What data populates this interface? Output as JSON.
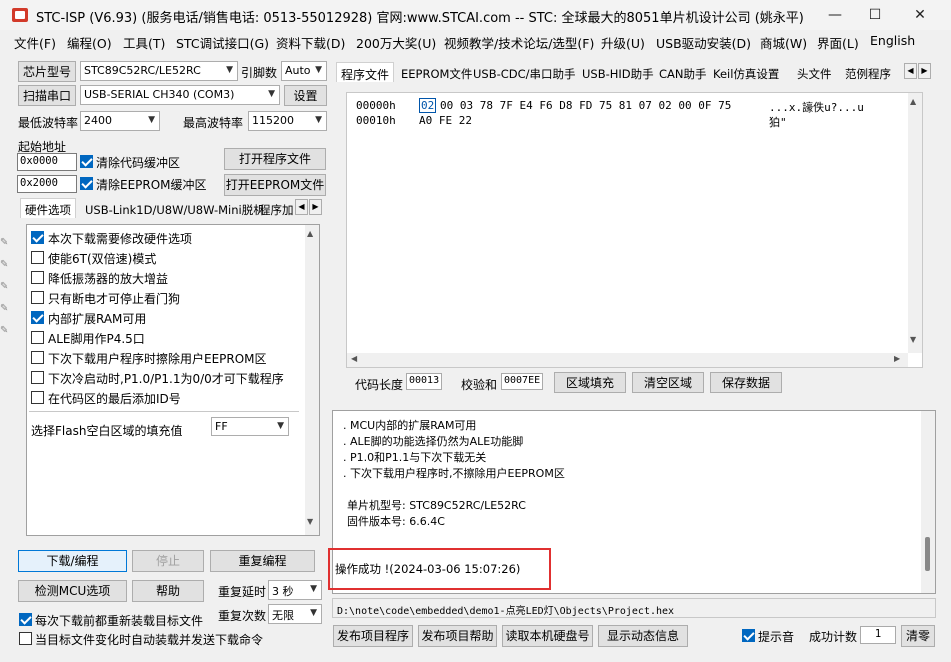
{
  "window": {
    "title": "STC-ISP (V6.93) (服务电话/销售电话: 0513-55012928) 官网:www.STCAI.com  -- STC: 全球最大的8051单片机设计公司 (姚永平)",
    "minimize": "—",
    "maximize": "☐",
    "close": "✕"
  },
  "menu": [
    "文件(F)",
    "编程(O)",
    "工具(T)",
    "STC调试接口(G)",
    "资料下载(D)",
    "200万大奖(U)",
    "视频教学/技术论坛/选型(F)",
    "升级(U)",
    "USB驱动安装(D)",
    "商城(W)",
    "界面(L)",
    "English"
  ],
  "left": {
    "chip_type_btn": "芯片型号",
    "chip_type_value": "STC89C52RC/LE52RC",
    "pin_count_label": "引脚数",
    "pin_count_value": "Auto",
    "scan_port_btn": "扫描串口",
    "port_value": "USB-SERIAL CH340 (COM3)",
    "settings_btn": "设置",
    "min_baud_label": "最低波特率",
    "min_baud_value": "2400",
    "max_baud_label": "最高波特率",
    "max_baud_value": "115200",
    "start_addr_label": "起始地址",
    "code_addr": "0x0000",
    "clear_code_label": "清除代码缓冲区",
    "open_prog_btn": "打开程序文件",
    "eeprom_addr": "0x2000",
    "clear_eeprom_label": "清除EEPROM缓冲区",
    "open_eeprom_btn": "打开EEPROM文件",
    "hw_tabs": [
      "硬件选项",
      "USB-Link1D/U8W/U8W-Mini脱机",
      "程序加"
    ],
    "options": [
      {
        "label": "本次下载需要修改硬件选项",
        "checked": true
      },
      {
        "label": "使能6T(双倍速)模式",
        "checked": false
      },
      {
        "label": "降低振荡器的放大增益",
        "checked": false
      },
      {
        "label": "只有断电才可停止看门狗",
        "checked": false
      },
      {
        "label": "内部扩展RAM可用",
        "checked": true
      },
      {
        "label": "ALE脚用作P4.5口",
        "checked": false
      },
      {
        "label": "下次下载用户程序时擦除用户EEPROM区",
        "checked": false
      },
      {
        "label": "下次冷启动时,P1.0/P1.1为0/0才可下载程序",
        "checked": false
      },
      {
        "label": "在代码区的最后添加ID号",
        "checked": false
      }
    ],
    "fill_label": "选择Flash空白区域的填充值",
    "fill_value": "FF",
    "download_btn": "下载/编程",
    "stop_btn": "停止",
    "reprogram_btn": "重复编程",
    "check_mcu_btn": "检测MCU选项",
    "help_btn": "帮助",
    "repeat_delay_label": "重复延时",
    "repeat_delay_value": "3 秒",
    "repeat_count_label": "重复次数",
    "repeat_count_value": "无限",
    "reload_label": "每次下载前都重新装载目标文件",
    "reload_checked": true,
    "auto_label": "当目标文件变化时自动装载并发送下载命令",
    "auto_checked": false
  },
  "right": {
    "tabs": [
      "程序文件",
      "EEPROM文件",
      "USB-CDC/串口助手",
      "USB-HID助手",
      "CAN助手",
      "Keil仿真设置",
      "头文件",
      "范例程序"
    ],
    "hex_rows": [
      {
        "addr": "00000h",
        "first": "02",
        "bytes": "00 03 78 7F E4 F6 D8 FD 75 81 07 02 00 0F 75",
        "ascii": "...x.譹佚u?...u"
      },
      {
        "addr": "00010h",
        "first": "",
        "bytes": "A0 FE 22",
        "ascii": "狛\""
      }
    ],
    "code_len_label": "代码长度",
    "code_len_value": "00013",
    "checksum_label": "校验和",
    "checksum_value": "0007EE",
    "fill_area_btn": "区域填充",
    "clear_area_btn": "清空区域",
    "save_btn": "保存数据",
    "log_lines": [
      ". MCU内部的扩展RAM可用",
      ". ALE脚的功能选择仍然为ALE功能脚",
      ". P1.0和P1.1与下次下载无关",
      ". 下次下载用户程序时,不擦除用户EEPROM区",
      "",
      "单片机型号: STC89C52RC/LE52RC",
      "固件版本号: 6.6.4C"
    ],
    "success_msg": "操作成功 !(2024-03-06 15:07:26)",
    "file_path": "D:\\note\\code\\embedded\\demo1-点亮LED灯\\Objects\\Project.hex",
    "publish_prog_btn": "发布项目程序",
    "publish_help_btn": "发布项目帮助",
    "read_disk_btn": "读取本机硬盘号",
    "show_dynamic_btn": "显示动态信息",
    "beep_label": "提示音",
    "beep_checked": true,
    "success_count_label": "成功计数",
    "success_count_value": "1",
    "clear_btn": "清零"
  },
  "colors": {
    "accent": "#0067c0",
    "highlight_red": "#e03030",
    "hex_select": "#0055aa"
  }
}
